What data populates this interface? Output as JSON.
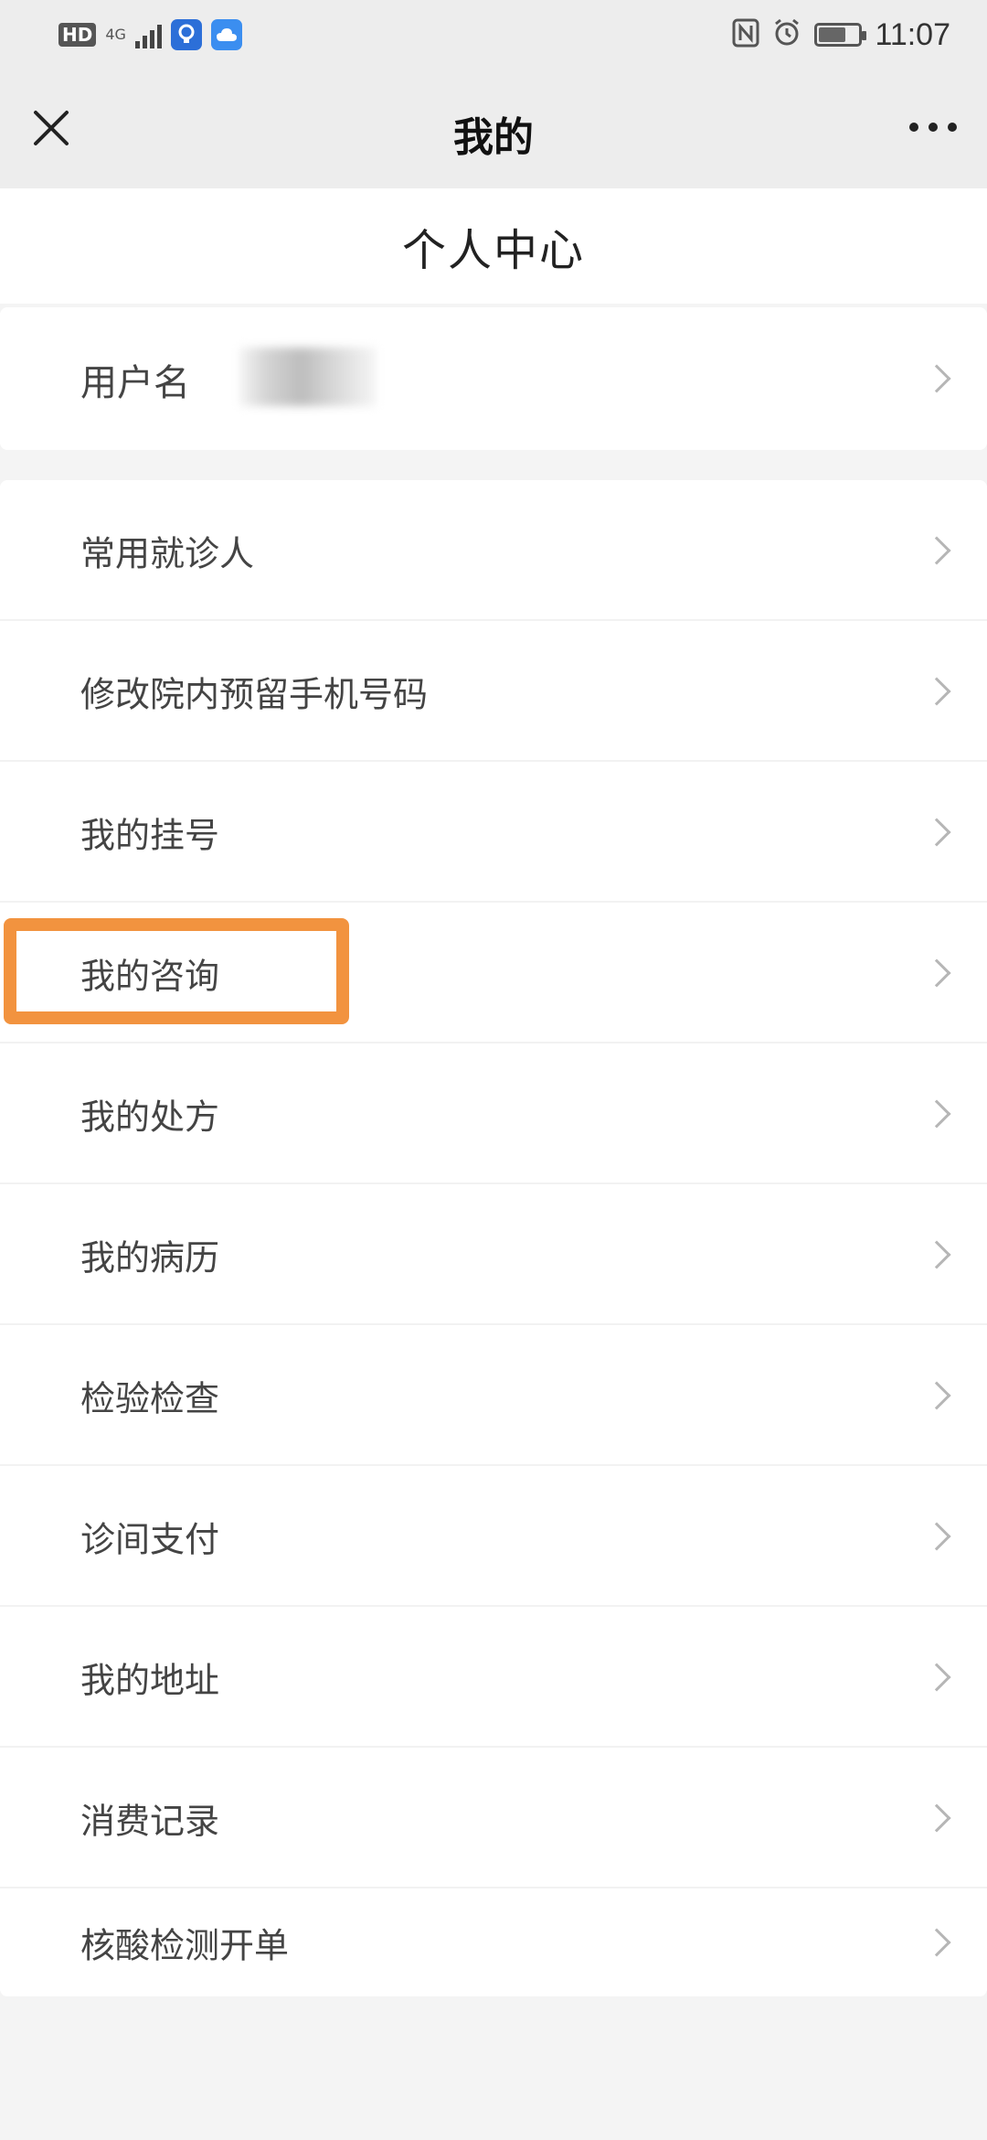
{
  "status_bar": {
    "hd": "HD",
    "network": "4G",
    "time": "11:07",
    "battery_level": 0.7
  },
  "nav": {
    "title": "我的",
    "close_icon": "close-icon",
    "more_icon": "more-icon"
  },
  "page": {
    "title": "个人中心"
  },
  "user": {
    "label": "用户名"
  },
  "menu": {
    "items": [
      {
        "label": "常用就诊人"
      },
      {
        "label": "修改院内预留手机号码"
      },
      {
        "label": "我的挂号"
      },
      {
        "label": "我的咨询",
        "highlighted": true
      },
      {
        "label": "我的处方"
      },
      {
        "label": "我的病历"
      },
      {
        "label": "检验检查"
      },
      {
        "label": "诊间支付"
      },
      {
        "label": "我的地址"
      },
      {
        "label": "消费记录"
      },
      {
        "label": "核酸检测开单"
      }
    ]
  },
  "colors": {
    "highlight": "#f2933f",
    "nav_bg": "#ededed",
    "page_bg": "#f4f4f4"
  }
}
